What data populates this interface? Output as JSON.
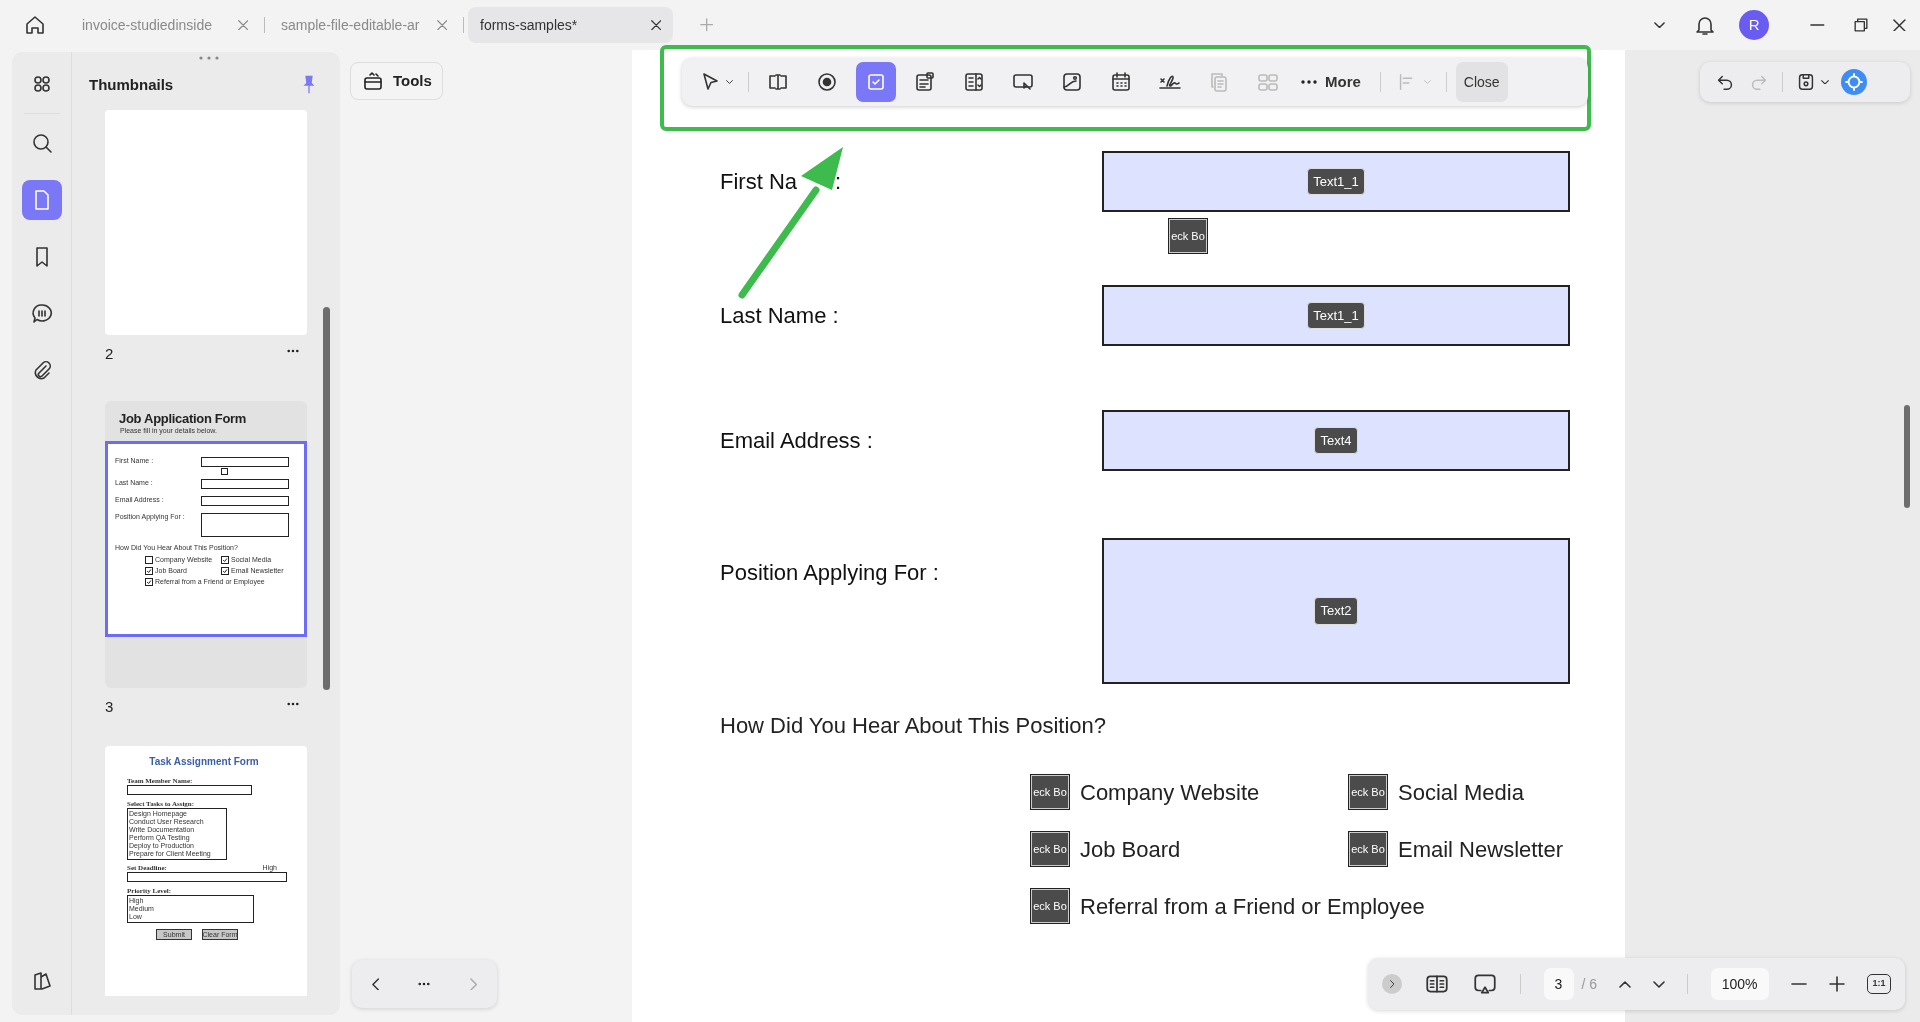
{
  "tabs": [
    {
      "label": "invoice-studiedinside",
      "selected": false
    },
    {
      "label": "sample-file-editable-ar",
      "selected": false
    },
    {
      "label": "forms-samples*",
      "selected": true
    }
  ],
  "account": {
    "initial": "R"
  },
  "sidebar": {
    "items": [
      {
        "kind": "apps",
        "selected": false
      },
      {
        "kind": "search",
        "selected": false
      },
      {
        "kind": "pages",
        "selected": true
      },
      {
        "kind": "bookmark",
        "selected": false
      },
      {
        "kind": "comment",
        "selected": false
      },
      {
        "kind": "attachment",
        "selected": false
      }
    ]
  },
  "thumbnails": {
    "title": "Thumbnails",
    "pages": [
      {
        "number": "2",
        "kind": "blank",
        "selected": false
      },
      {
        "number": "3",
        "kind": "job",
        "selected": true,
        "title": "Job Application Form",
        "subtitle": "Please fill in your details below.",
        "labels": [
          "First Name :",
          "Last Name :",
          "Email Address :",
          "Position Applying For :"
        ],
        "question": "How Did You Hear About This Position?",
        "options": [
          {
            "label": "Company Website",
            "checked": false
          },
          {
            "label": "Social Media",
            "checked": true
          },
          {
            "label": "Job Board",
            "checked": true
          },
          {
            "label": "Email Newsletter",
            "checked": true
          },
          {
            "label": "Referral from a Friend or Employee",
            "checked": true
          }
        ]
      },
      {
        "kind": "task",
        "selected": false,
        "title": "Task Assignment Form",
        "name_label": "Team Member Name:",
        "tasks_label": "Select Tasks to Assign:",
        "tasks": [
          "Design Homepage",
          "Conduct User Research",
          "Write Documentation",
          "Perform QA Testing",
          "Deploy to Production",
          "Prepare for Client Meeting"
        ],
        "deadline_label": "Set Deadline:",
        "deadline_note": "High",
        "priority_label": "Priority Level:",
        "priorities": [
          "High",
          "Medium",
          "Low"
        ],
        "buttons": [
          "Submit",
          "Clear Form"
        ]
      }
    ]
  },
  "tools_button": "Tools",
  "form_toolbar": {
    "tools": [
      {
        "kind": "pointer",
        "selected": false,
        "disabled": false
      },
      {
        "kind": "text-field",
        "selected": false,
        "disabled": false
      },
      {
        "kind": "radio",
        "selected": false,
        "disabled": false
      },
      {
        "kind": "checkbox",
        "selected": true,
        "disabled": false
      },
      {
        "kind": "combo-box",
        "selected": false,
        "disabled": false
      },
      {
        "kind": "list-box",
        "selected": false,
        "disabled": false
      },
      {
        "kind": "push-button",
        "selected": false,
        "disabled": false
      },
      {
        "kind": "image",
        "selected": false,
        "disabled": false
      },
      {
        "kind": "date",
        "selected": false,
        "disabled": false
      },
      {
        "kind": "signature",
        "selected": false,
        "disabled": false
      },
      {
        "kind": "duplicate",
        "selected": false,
        "disabled": true
      },
      {
        "kind": "grid",
        "selected": false,
        "disabled": true
      }
    ],
    "more": "More",
    "close": "Close"
  },
  "form": {
    "fields": [
      {
        "label": "First Na",
        "label_end": ":",
        "tag": "Text1_1",
        "kind": "single"
      },
      {
        "label": "Last Name :",
        "tag": "Text1_1",
        "kind": "single"
      },
      {
        "label": "Email Address :",
        "tag": "Text4",
        "kind": "single"
      },
      {
        "label": "Position Applying For :",
        "tag": "Text2",
        "kind": "multi"
      }
    ],
    "loose_checkbox": "eck Bo",
    "question": "How Did You Hear About This Position?",
    "options": [
      {
        "label": "Company Website",
        "tag": "eck Bo"
      },
      {
        "label": "Social Media",
        "tag": "eck Bo"
      },
      {
        "label": "Job Board",
        "tag": "eck Bo"
      },
      {
        "label": "Email Newsletter",
        "tag": "eck Bo"
      },
      {
        "label": "Referral from a Friend or Employee",
        "tag": "eck Bo"
      }
    ]
  },
  "page_nav": {
    "page": "3",
    "total": "/ 6",
    "zoom": "100%",
    "fit": "1:1"
  }
}
